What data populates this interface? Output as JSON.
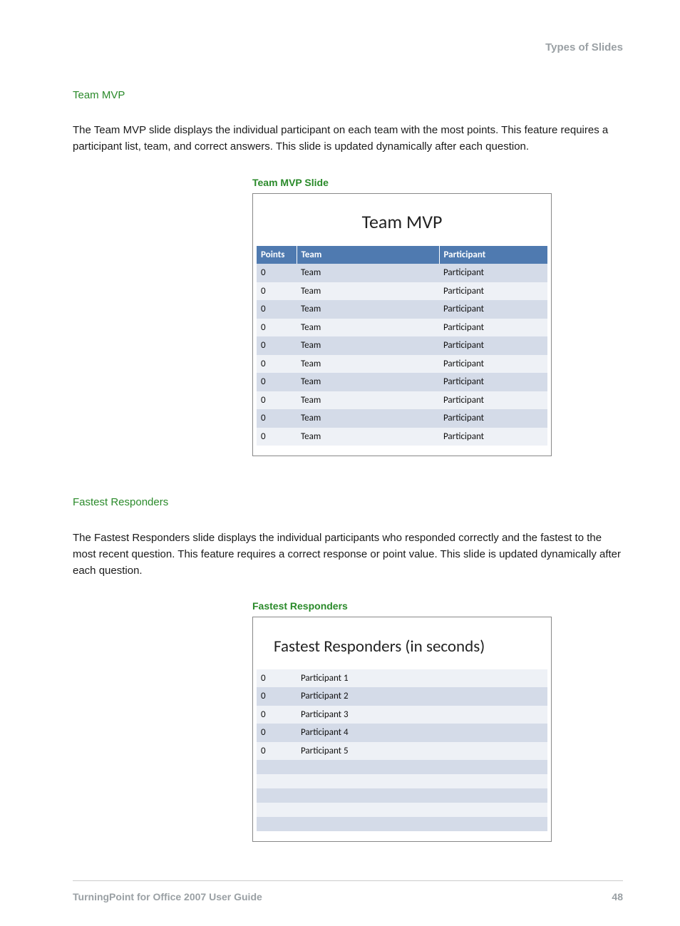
{
  "header": {
    "right": "Types of Slides"
  },
  "section1": {
    "heading": "Team MVP",
    "para": "The Team MVP slide displays the individual participant on each team with the most points. This feature requires a participant list, team, and correct answers. This slide is updated dynamically after each question.",
    "caption": "Team MVP Slide",
    "slideTitle": "Team MVP",
    "headers": {
      "points": "Points",
      "team": "Team",
      "participant": "Participant"
    },
    "rows": [
      {
        "points": "0",
        "team": "Team",
        "participant": "Participant"
      },
      {
        "points": "0",
        "team": "Team",
        "participant": "Participant"
      },
      {
        "points": "0",
        "team": "Team",
        "participant": "Participant"
      },
      {
        "points": "0",
        "team": "Team",
        "participant": "Participant"
      },
      {
        "points": "0",
        "team": "Team",
        "participant": "Participant"
      },
      {
        "points": "0",
        "team": "Team",
        "participant": "Participant"
      },
      {
        "points": "0",
        "team": "Team",
        "participant": "Participant"
      },
      {
        "points": "0",
        "team": "Team",
        "participant": "Participant"
      },
      {
        "points": "0",
        "team": "Team",
        "participant": "Participant"
      },
      {
        "points": "0",
        "team": "Team",
        "participant": "Participant"
      }
    ]
  },
  "section2": {
    "heading": "Fastest Responders",
    "para": "The Fastest Responders slide displays the individual participants who responded correctly and the fastest to the most recent question. This feature requires a correct response or point value. This slide is updated dynamically after each question.",
    "caption": "Fastest Responders",
    "slideTitle": "Fastest Responders (in seconds)",
    "rows": [
      {
        "pts": "0",
        "name": "Participant 1"
      },
      {
        "pts": "0",
        "name": "Participant 2"
      },
      {
        "pts": "0",
        "name": "Participant 3"
      },
      {
        "pts": "0",
        "name": "Participant 4"
      },
      {
        "pts": "0",
        "name": "Participant 5"
      },
      {
        "pts": "",
        "name": ""
      },
      {
        "pts": "",
        "name": ""
      },
      {
        "pts": "",
        "name": ""
      },
      {
        "pts": "",
        "name": ""
      },
      {
        "pts": "",
        "name": ""
      }
    ]
  },
  "footer": {
    "title": "TurningPoint for Office 2007 User Guide",
    "page": "48"
  }
}
